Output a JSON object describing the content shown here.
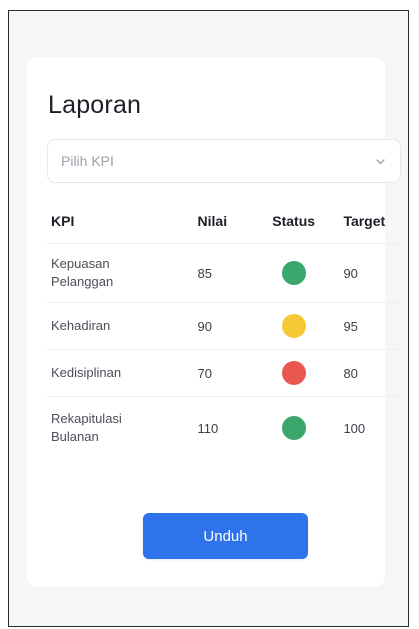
{
  "page": {
    "title": "Laporan"
  },
  "select": {
    "placeholder": "Pilih KPI",
    "icon": "chevron-down-icon"
  },
  "table": {
    "headers": [
      "KPI",
      "Nilai",
      "Status",
      "Target"
    ],
    "rows": [
      {
        "kpi": "Kepuasan Pelanggan",
        "nilai": "85",
        "status_color": "#3aa66b",
        "target": "90"
      },
      {
        "kpi": "Kehadiran",
        "nilai": "90",
        "status_color": "#f6c833",
        "target": "95"
      },
      {
        "kpi": "Kedisiplinan",
        "nilai": "70",
        "status_color": "#e8584f",
        "target": "80"
      },
      {
        "kpi": "Rekapitulasi Bulanan",
        "nilai": "110",
        "status_color": "#3aa66b",
        "target": "100"
      }
    ]
  },
  "button": {
    "label": "Unduh",
    "color": "#2f73ea"
  }
}
